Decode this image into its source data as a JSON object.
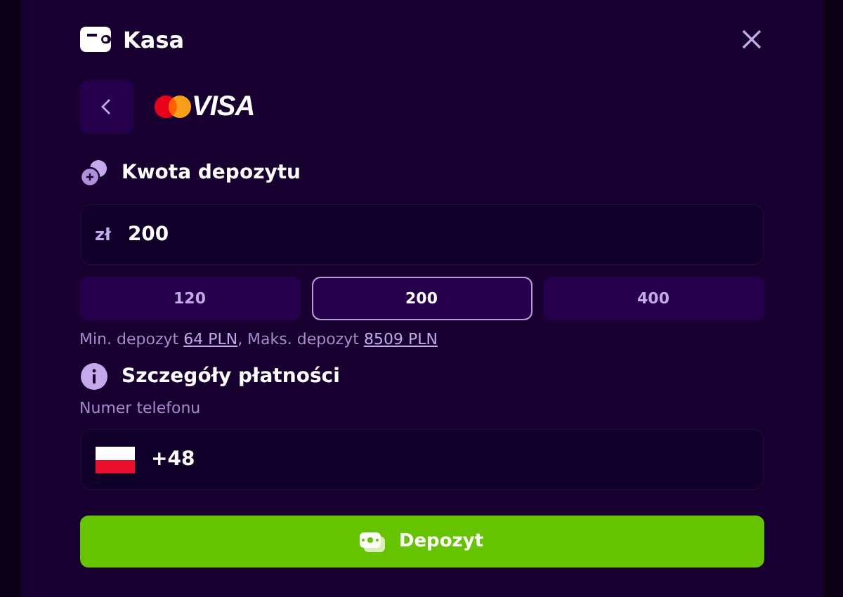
{
  "header": {
    "title": "Kasa"
  },
  "payment_method": {
    "logo_text": "VISA"
  },
  "amount_section": {
    "heading": "Kwota depozytu",
    "currency": "zł",
    "value": "200",
    "presets": [
      {
        "label": "120",
        "selected": false
      },
      {
        "label": "200",
        "selected": true
      },
      {
        "label": "400",
        "selected": false
      }
    ],
    "limits": {
      "min_label": "Min. depozyt",
      "min_value": "64 PLN",
      "max_label": ", Maks. depozyt",
      "max_value": "8509 PLN"
    }
  },
  "details_section": {
    "heading": "Szczegóły płatności",
    "phone_label": "Numer telefonu",
    "phone_prefix": "+48"
  },
  "submit": {
    "label": "Depozyt"
  }
}
